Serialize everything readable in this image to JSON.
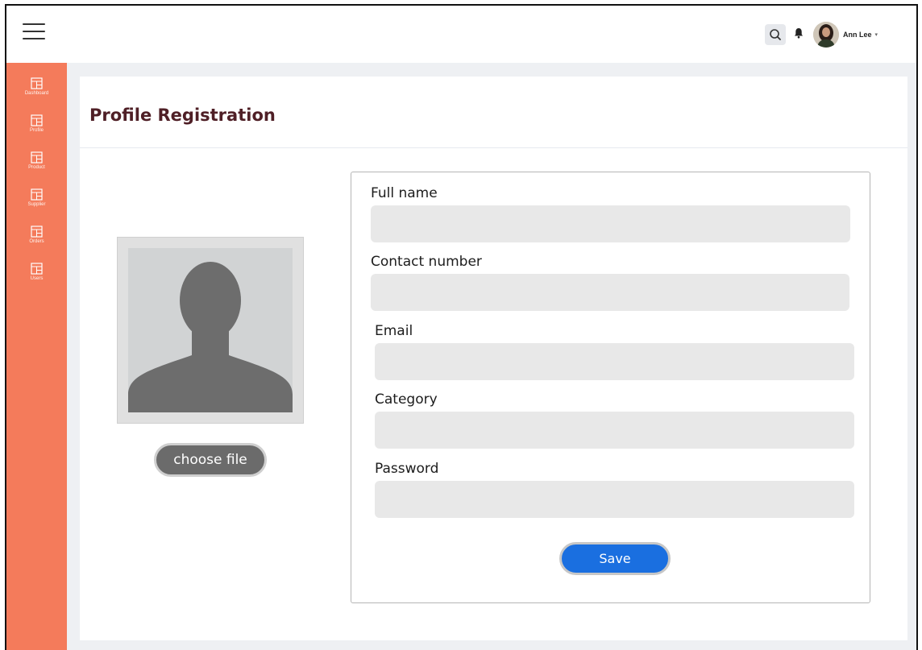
{
  "header": {
    "menu_icon": "hamburger-icon",
    "search_icon": "search-icon",
    "notification_icon": "bell-icon",
    "user_name": "Ann Lee",
    "caret": "▾"
  },
  "sidebar": {
    "items": [
      {
        "label": "Dashboard",
        "icon": "grid-icon"
      },
      {
        "label": "Profile",
        "icon": "grid-icon"
      },
      {
        "label": "Product",
        "icon": "grid-icon"
      },
      {
        "label": "Supplier",
        "icon": "grid-icon"
      },
      {
        "label": "Orders",
        "icon": "grid-icon"
      },
      {
        "label": "Users",
        "icon": "grid-icon"
      }
    ]
  },
  "page": {
    "title": "Profile Registration",
    "choose_file_label": "choose file",
    "save_label": "Save"
  },
  "form": {
    "fields": [
      {
        "label": "Full name",
        "value": "",
        "placeholder": ""
      },
      {
        "label": "Contact number",
        "value": "",
        "placeholder": ""
      },
      {
        "label": "Email",
        "value": "",
        "placeholder": ""
      },
      {
        "label": "Category",
        "value": "",
        "placeholder": ""
      },
      {
        "label": "Password",
        "value": "",
        "placeholder": ""
      }
    ]
  },
  "colors": {
    "sidebar": "#f47b5b",
    "title": "#4f1f26",
    "save_button": "#1a6fe0",
    "choose_file_button": "#6b6b6b",
    "input_bg": "#e8e8e8"
  }
}
